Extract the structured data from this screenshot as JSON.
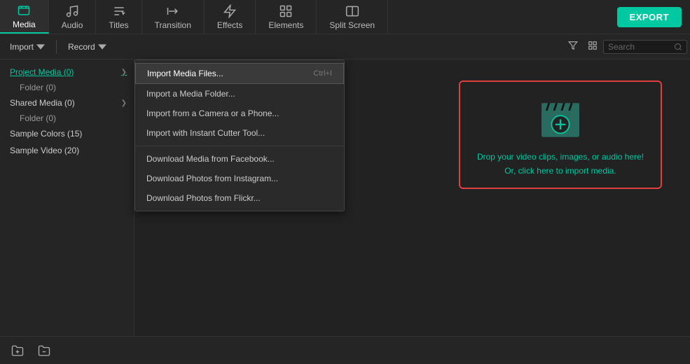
{
  "nav": {
    "items": [
      {
        "id": "media",
        "label": "Media",
        "active": true
      },
      {
        "id": "audio",
        "label": "Audio",
        "active": false
      },
      {
        "id": "titles",
        "label": "Titles",
        "active": false
      },
      {
        "id": "transition",
        "label": "Transition",
        "active": false
      },
      {
        "id": "effects",
        "label": "Effects",
        "active": false
      },
      {
        "id": "elements",
        "label": "Elements",
        "active": false
      },
      {
        "id": "splitscreen",
        "label": "Split Screen",
        "active": false
      }
    ],
    "export_label": "EXPORT"
  },
  "toolbar": {
    "import_label": "Import",
    "record_label": "Record",
    "search_placeholder": "Search"
  },
  "sidebar": {
    "items": [
      {
        "label": "Project Media (0)",
        "active": true,
        "sub": "Folder (0)"
      },
      {
        "label": "Shared Media (0)",
        "active": false,
        "sub": "Folder (0)"
      },
      {
        "label": "Sample Colors (15)",
        "active": false
      },
      {
        "label": "Sample Video (20)",
        "active": false
      }
    ]
  },
  "dropdown": {
    "items": [
      {
        "label": "Import Media Files...",
        "shortcut": "Ctrl+I",
        "highlighted": true
      },
      {
        "label": "Import a Media Folder...",
        "shortcut": ""
      },
      {
        "label": "Import from a Camera or a Phone...",
        "shortcut": ""
      },
      {
        "label": "Import with Instant Cutter Tool...",
        "shortcut": ""
      },
      {
        "separator": true
      },
      {
        "label": "Download Media from Facebook...",
        "shortcut": ""
      },
      {
        "label": "Download Photos from Instagram...",
        "shortcut": ""
      },
      {
        "label": "Download Photos from Flickr...",
        "shortcut": ""
      }
    ]
  },
  "dropzone": {
    "line1": "Drop your video clips, images, or audio here!",
    "line2": "Or, click here to import media."
  },
  "bottom": {
    "add_folder_label": "Add Folder",
    "delete_folder_label": "Delete Folder"
  }
}
